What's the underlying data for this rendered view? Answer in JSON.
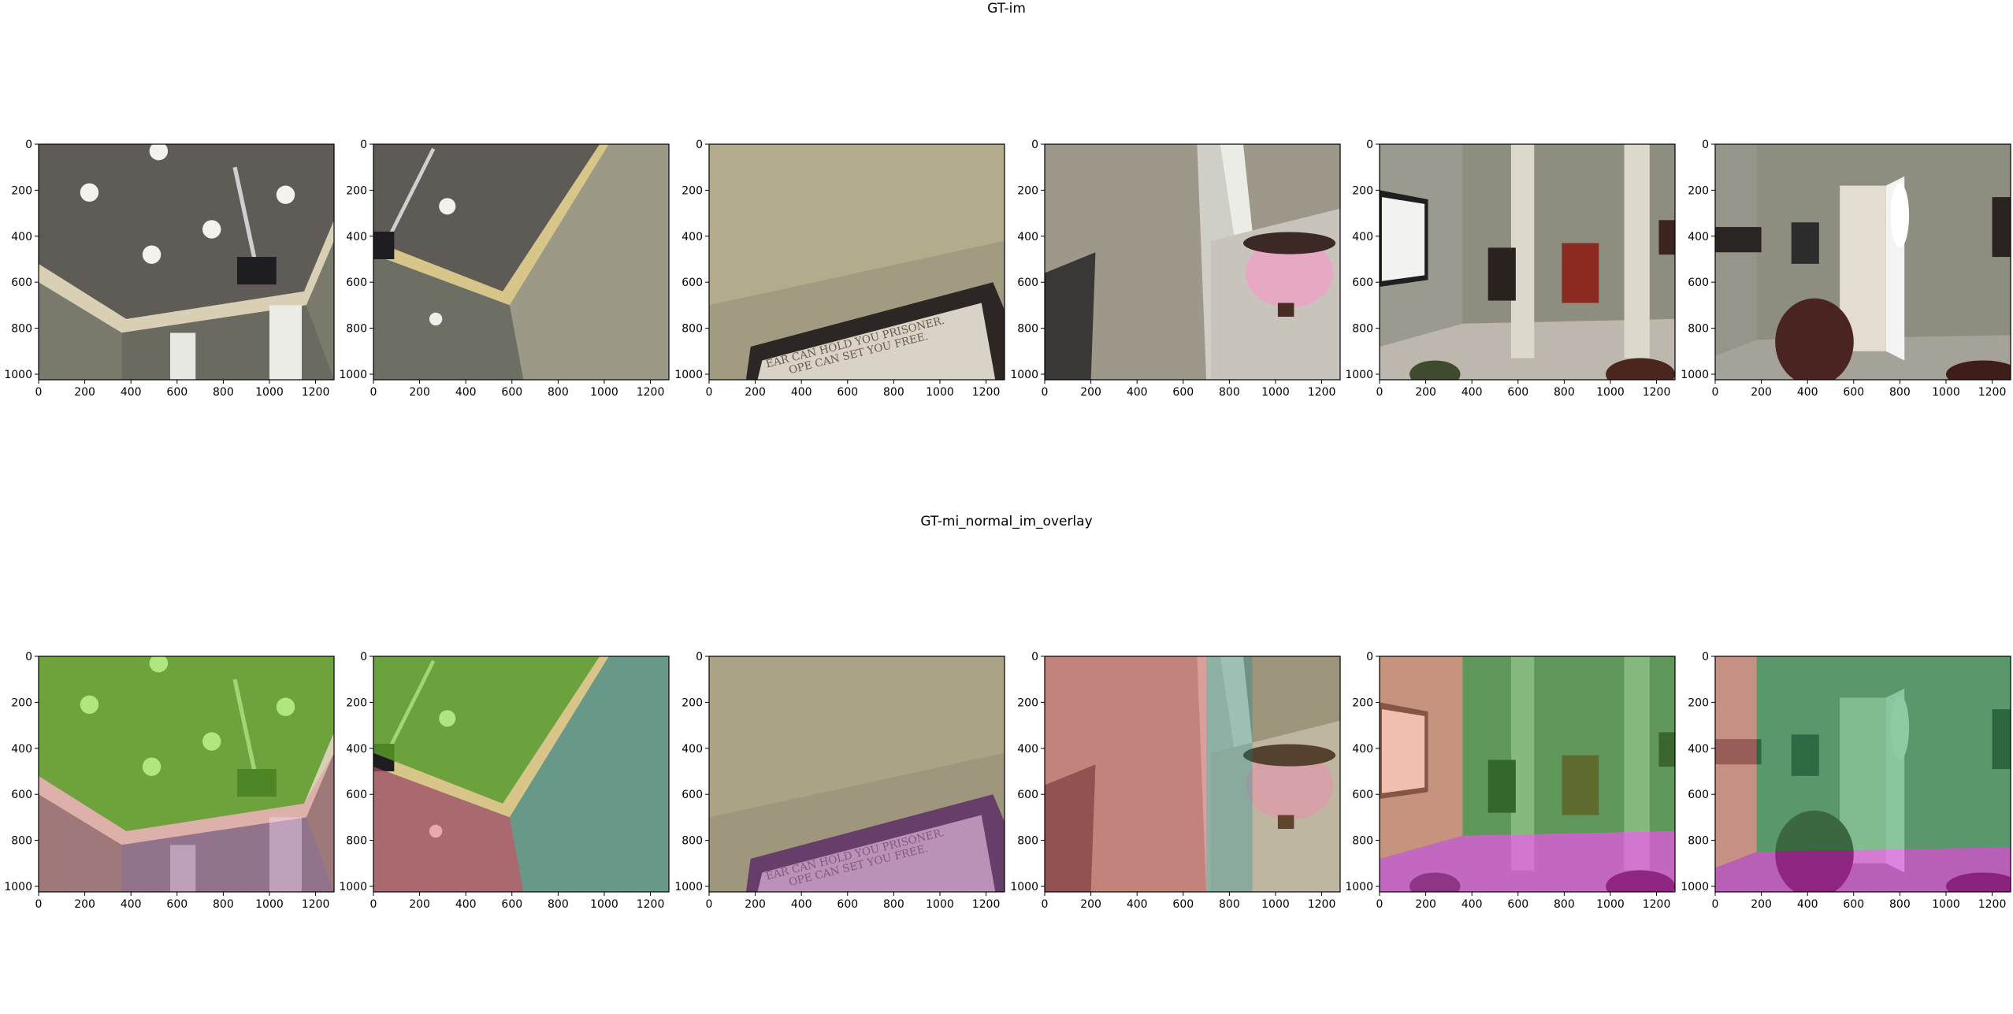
{
  "figure": {
    "rows": [
      {
        "title": "GT-im",
        "panels": [
          {
            "scene": "ceiling-projector"
          },
          {
            "scene": "ceiling-corner"
          },
          {
            "scene": "wall-plaque"
          },
          {
            "scene": "wall-sconce"
          },
          {
            "scene": "room-columns-posters"
          },
          {
            "scene": "room-door-chair"
          }
        ]
      },
      {
        "title": "GT-mi_normal_im_overlay",
        "panels": [
          {
            "scene": "ceiling-projector"
          },
          {
            "scene": "ceiling-corner"
          },
          {
            "scene": "wall-plaque"
          },
          {
            "scene": "wall-sconce"
          },
          {
            "scene": "room-columns-posters"
          },
          {
            "scene": "room-door-chair"
          }
        ]
      }
    ],
    "plaque_text": [
      "EAR CAN HOLD YOU PRISONER.",
      "OPE CAN SET YOU FREE."
    ]
  },
  "chart_data": {
    "type": "image-grid",
    "rows": 2,
    "cols": 6,
    "xlim": [
      0,
      1280
    ],
    "ylim": [
      1024,
      0
    ],
    "xticks": [
      0,
      200,
      400,
      600,
      800,
      1000,
      1200
    ],
    "yticks": [
      0,
      200,
      400,
      600,
      800,
      1000
    ]
  }
}
